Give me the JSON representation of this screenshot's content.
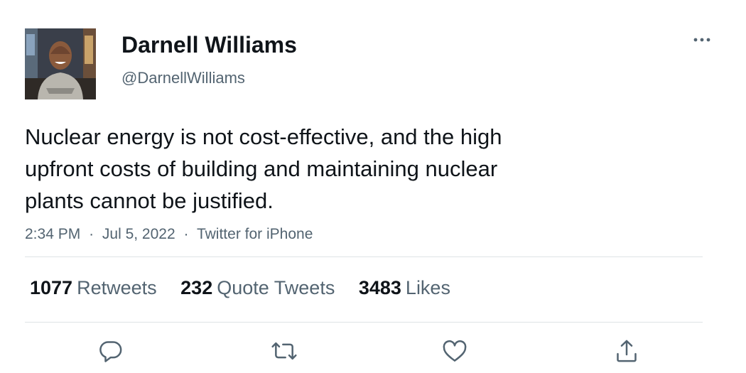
{
  "user": {
    "display_name": "Darnell Williams",
    "handle": "@DarnellWilliams"
  },
  "tweet": {
    "text_lines": [
      "Nuclear energy is not cost-effective, and the high",
      "upfront costs of building and maintaining nuclear",
      "plants cannot be justified."
    ],
    "time": "2:34 PM",
    "date": "Jul 5, 2022",
    "source": "Twitter for iPhone",
    "separator": "·"
  },
  "stats": {
    "retweets_count": "1077",
    "retweets_label": "Retweets",
    "quotes_count": "232",
    "quotes_label": "Quote Tweets",
    "likes_count": "3483",
    "likes_label": "Likes"
  },
  "icons": {
    "more": "more-horizontal-icon",
    "reply": "reply-icon",
    "retweet": "retweet-icon",
    "like": "heart-icon",
    "share": "share-icon"
  },
  "colors": {
    "text": "#0f1419",
    "secondary": "#536471",
    "divider": "#dfe3e6"
  }
}
